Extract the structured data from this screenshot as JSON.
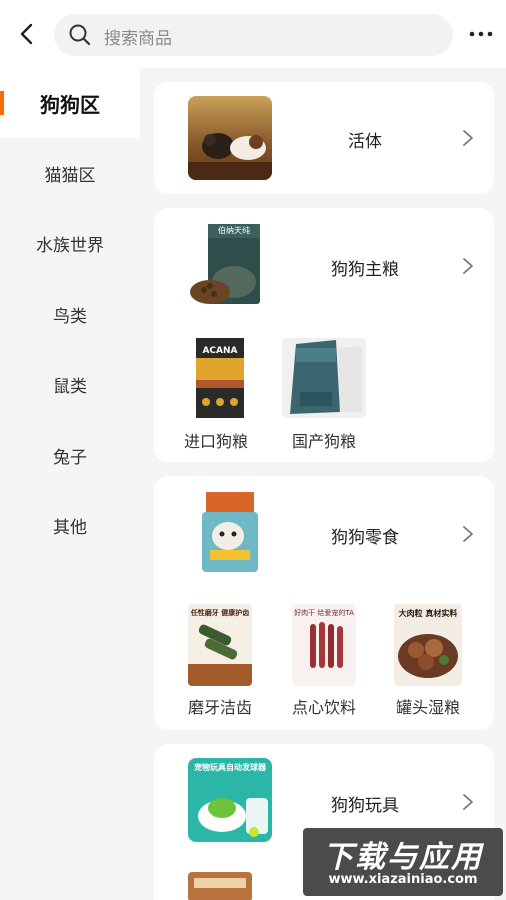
{
  "search": {
    "placeholder": "搜索商品"
  },
  "sidebar": {
    "items": [
      {
        "label": "狗狗区",
        "active": true
      },
      {
        "label": "猫猫区"
      },
      {
        "label": "水族世界"
      },
      {
        "label": "鸟类"
      },
      {
        "label": "鼠类"
      },
      {
        "label": "兔子"
      },
      {
        "label": "其他"
      }
    ]
  },
  "categories": [
    {
      "title": "活体",
      "icon": "puppy-photo"
    },
    {
      "title": "狗狗主粮",
      "icon": "dog-food-bag",
      "subs": [
        {
          "label": "进口狗粮"
        },
        {
          "label": "国产狗粮"
        }
      ]
    },
    {
      "title": "狗狗零食",
      "icon": "dog-snack-bag",
      "subs": [
        {
          "label": "磨牙洁齿"
        },
        {
          "label": "点心饮料"
        },
        {
          "label": "罐头湿粮"
        }
      ]
    },
    {
      "title": "狗狗玩具",
      "icon": "ball-launcher-toy"
    }
  ],
  "product_text": {
    "dog_food_brand": "伯纳天纯",
    "dental_promo": "任性磨牙 健康护齿",
    "snack_promo": "好肉干 给爱宠的TA",
    "can_promo": "大肉粒 真材实料",
    "toy_promo": "宠物玩具自动发球器",
    "acana_brand": "ACANA"
  },
  "watermark": {
    "main": "下载与应用",
    "sub": "www.xiazainiao.com"
  },
  "colors": {
    "accent": "#ff6a00",
    "background": "#f5f5f5",
    "card": "#ffffff"
  }
}
